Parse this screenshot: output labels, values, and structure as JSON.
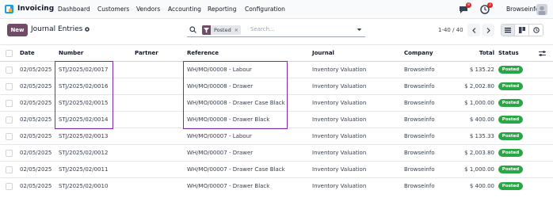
{
  "app": {
    "name": "Invoicing"
  },
  "nav": {
    "menu": [
      "Dashboard",
      "Customers",
      "Vendors",
      "Accounting",
      "Reporting",
      "Configuration"
    ],
    "messages_count": "8",
    "activities_count": "2",
    "company": "Browseinfo"
  },
  "control": {
    "new_label": "New",
    "title": "Journal Entries",
    "filter_label": "Posted",
    "search_placeholder": "Search...",
    "pager": "1-40 / 40"
  },
  "table": {
    "headers": [
      "Date",
      "Number",
      "Partner",
      "Reference",
      "Journal",
      "Company",
      "Total",
      "Status"
    ],
    "rows": [
      {
        "date": "02/05/2025",
        "number": "STJ/2025/02/0017",
        "partner": "",
        "reference": "WH/MO/00008 - Labour",
        "journal": "Inventory Valuation",
        "company": "Browseinfo",
        "total": "$ 135.22",
        "status": "Posted"
      },
      {
        "date": "02/05/2025",
        "number": "STJ/2025/02/0016",
        "partner": "",
        "reference": "WH/MO/00008 - Drawer",
        "journal": "Inventory Valuation",
        "company": "Browseinfo",
        "total": "$ 2,002.80",
        "status": "Posted"
      },
      {
        "date": "02/05/2025",
        "number": "STJ/2025/02/0015",
        "partner": "",
        "reference": "WH/MO/00008 - Drawer Case Black",
        "journal": "Inventory Valuation",
        "company": "Browseinfo",
        "total": "$ 1,000.00",
        "status": "Posted"
      },
      {
        "date": "02/05/2025",
        "number": "STJ/2025/02/0014",
        "partner": "",
        "reference": "WH/MO/00008 - Drawer Black",
        "journal": "Inventory Valuation",
        "company": "Browseinfo",
        "total": "$ 400.00",
        "status": "Posted"
      },
      {
        "date": "02/05/2025",
        "number": "STJ/2025/02/0013",
        "partner": "",
        "reference": "WH/MO/00007 - Labour",
        "journal": "Inventory Valuation",
        "company": "Browseinfo",
        "total": "$ 135.33",
        "status": "Posted"
      },
      {
        "date": "02/05/2025",
        "number": "STJ/2025/02/0012",
        "partner": "",
        "reference": "WH/MO/00007 - Drawer",
        "journal": "Inventory Valuation",
        "company": "Browseinfo",
        "total": "$ 2,003.80",
        "status": "Posted"
      },
      {
        "date": "02/05/2025",
        "number": "STJ/2025/02/0011",
        "partner": "",
        "reference": "WH/MO/00007 - Drawer Case Black",
        "journal": "Inventory Valuation",
        "company": "Browseinfo",
        "total": "$ 1,000.00",
        "status": "Posted"
      },
      {
        "date": "02/05/2025",
        "number": "STJ/2025/02/0010",
        "partner": "",
        "reference": "WH/MO/00007 - Drawer Black",
        "journal": "Inventory Valuation",
        "company": "Browseinfo",
        "total": "$ 400.00",
        "status": "Posted"
      }
    ]
  },
  "colors": {
    "brand": "#714b67",
    "posted": "#28a745",
    "highlight": "#7b2ba8"
  }
}
